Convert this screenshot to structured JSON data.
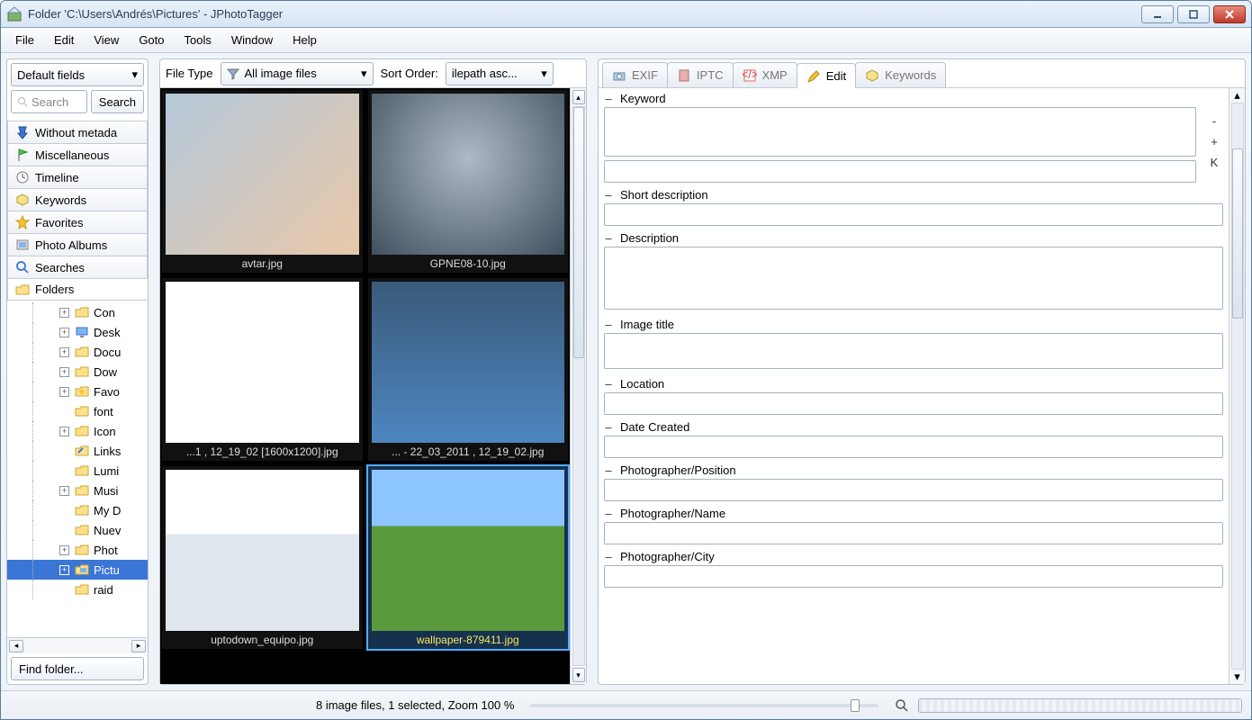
{
  "window": {
    "title": "Folder 'C:\\Users\\Andrés\\Pictures' - JPhotoTagger"
  },
  "menu": [
    "File",
    "Edit",
    "View",
    "Goto",
    "Tools",
    "Window",
    "Help"
  ],
  "left": {
    "fields_combo": "Default fields",
    "search_placeholder": "Search",
    "search_button": "Search",
    "tabs": [
      {
        "name": "without-metadata",
        "label": "Without metada",
        "icon": "pin"
      },
      {
        "name": "miscellaneous",
        "label": "Miscellaneous",
        "icon": "flag"
      },
      {
        "name": "timeline",
        "label": "Timeline",
        "icon": "clock"
      },
      {
        "name": "keywords",
        "label": "Keywords",
        "icon": "tag"
      },
      {
        "name": "favorites",
        "label": "Favorites",
        "icon": "star"
      },
      {
        "name": "photo-albums",
        "label": "Photo Albums",
        "icon": "album"
      },
      {
        "name": "searches",
        "label": "Searches",
        "icon": "magnifier"
      },
      {
        "name": "folders",
        "label": "Folders",
        "icon": "folder",
        "active": true
      }
    ],
    "tree": [
      {
        "exp": "+",
        "label": "Con",
        "kind": "folder"
      },
      {
        "exp": "+",
        "label": "Desk",
        "kind": "desktop"
      },
      {
        "exp": "+",
        "label": "Docu",
        "kind": "folder"
      },
      {
        "exp": "+",
        "label": "Dow",
        "kind": "folder"
      },
      {
        "exp": "+",
        "label": "Favo",
        "kind": "fav"
      },
      {
        "exp": "",
        "label": "font",
        "kind": "folder"
      },
      {
        "exp": "+",
        "label": "Icon",
        "kind": "folder"
      },
      {
        "exp": "",
        "label": "Links",
        "kind": "link"
      },
      {
        "exp": "",
        "label": "Lumi",
        "kind": "folder"
      },
      {
        "exp": "+",
        "label": "Musi",
        "kind": "folder"
      },
      {
        "exp": "",
        "label": "My D",
        "kind": "folder"
      },
      {
        "exp": "",
        "label": "Nuev",
        "kind": "folder"
      },
      {
        "exp": "+",
        "label": "Phot",
        "kind": "folder"
      },
      {
        "exp": "+",
        "label": "Pictu",
        "kind": "pic",
        "selected": true
      },
      {
        "exp": "",
        "label": "raid",
        "kind": "folder"
      }
    ],
    "find_button": "Find folder..."
  },
  "center": {
    "filetype_label": "File Type",
    "filetype_value": "All image files",
    "sort_label": "Sort Order:",
    "sort_value": "ilepath asc...",
    "thumbs": [
      {
        "caption": "avtar.jpg"
      },
      {
        "caption": "GPNE08-10.jpg"
      },
      {
        "caption": "...1 , 12_19_02 [1600x1200].jpg"
      },
      {
        "caption": "... - 22_03_2011 , 12_19_02.jpg"
      },
      {
        "caption": "uptodown_equipo.jpg"
      },
      {
        "caption": "wallpaper-879411.jpg",
        "selected": true
      }
    ]
  },
  "right": {
    "tabs": [
      {
        "name": "exif",
        "label": "EXIF",
        "icon": "camera"
      },
      {
        "name": "iptc",
        "label": "IPTC",
        "icon": "doc"
      },
      {
        "name": "xmp",
        "label": "XMP",
        "icon": "xml"
      },
      {
        "name": "edit",
        "label": "Edit",
        "icon": "pencil",
        "active": true
      },
      {
        "name": "keywords",
        "label": "Keywords",
        "icon": "tag"
      }
    ],
    "fields": [
      {
        "name": "keyword",
        "label": "Keyword",
        "rows": 3,
        "buttons": [
          "-",
          "+",
          "K"
        ],
        "secondary": true
      },
      {
        "name": "short-description",
        "label": "Short description",
        "rows": 1
      },
      {
        "name": "description",
        "label": "Description",
        "rows": 4
      },
      {
        "name": "image-title",
        "label": "Image title",
        "rows": 2
      },
      {
        "name": "location",
        "label": "Location",
        "rows": 1
      },
      {
        "name": "date-created",
        "label": "Date Created",
        "rows": 1
      },
      {
        "name": "photographer-position",
        "label": "Photographer/Position",
        "rows": 1
      },
      {
        "name": "photographer-name",
        "label": "Photographer/Name",
        "rows": 1
      },
      {
        "name": "photographer-city",
        "label": "Photographer/City",
        "rows": 1
      }
    ]
  },
  "statusbar": {
    "text": "8 image files, 1 selected, Zoom 100 %"
  }
}
